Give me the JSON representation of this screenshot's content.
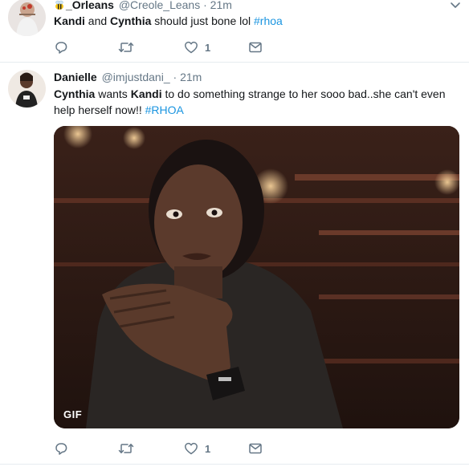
{
  "tweets": [
    {
      "name": "_Orleans",
      "handle": "@Creole_Leans",
      "separator": "·",
      "time": "21m",
      "text": {
        "part1": "Kandi",
        "part2": " and ",
        "part3": "Cynthia",
        "part4": " should just bone lol ",
        "hashtag": "#rhoa"
      },
      "actions": {
        "reply_count": "",
        "retweet_count": "",
        "like_count": "1"
      }
    },
    {
      "name": "Danielle",
      "handle": "@imjustdani_",
      "separator": "·",
      "time": "21m",
      "text": {
        "part1": "Cynthia",
        "part2": " wants ",
        "part3": "Kandi",
        "part4": " to do something strange to her sooo bad..she can't even help herself now!! ",
        "hashtag": "#RHOA"
      },
      "media": {
        "badge": "GIF"
      },
      "actions": {
        "reply_count": "",
        "retweet_count": "",
        "like_count": "1"
      }
    }
  ],
  "icons": {
    "caret": "chevron-down-icon",
    "reply": "reply-icon",
    "retweet": "retweet-icon",
    "like": "heart-icon",
    "message": "envelope-icon",
    "emoji": "bee-emoji-icon"
  },
  "colors": {
    "text": "#14171a",
    "secondary": "#657786",
    "link": "#1b95e0",
    "divider": "#e6ecf0"
  }
}
